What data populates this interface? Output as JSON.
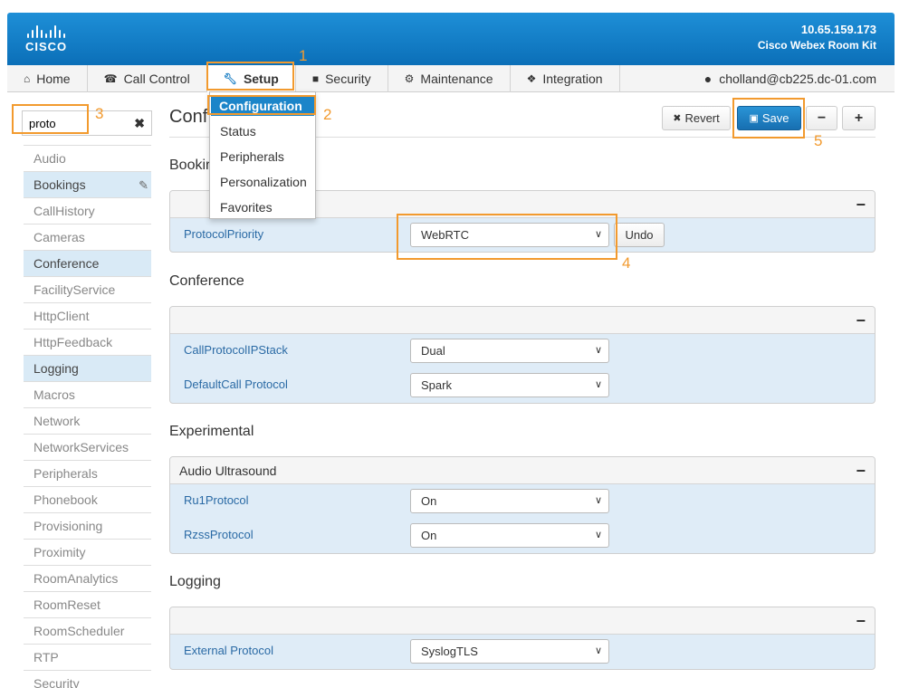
{
  "header": {
    "brand": "CISCO",
    "ip": "10.65.159.173",
    "device": "Cisco Webex Room Kit"
  },
  "nav": {
    "items": [
      {
        "label": "Home",
        "icon": "home-icon"
      },
      {
        "label": "Call Control",
        "icon": "phone-icon"
      },
      {
        "label": "Setup",
        "icon": "wrench-icon"
      },
      {
        "label": "Security",
        "icon": "lock-icon"
      },
      {
        "label": "Maintenance",
        "icon": "gear-icon"
      },
      {
        "label": "Integration",
        "icon": "puzzle-icon"
      }
    ],
    "user": "cholland@cb225.dc-01.com"
  },
  "setup_menu": {
    "items": [
      "Configuration",
      "Status",
      "Peripherals",
      "Personalization",
      "Favorites"
    ]
  },
  "search": {
    "value": "proto"
  },
  "sidebar": {
    "items": [
      {
        "label": "Audio"
      },
      {
        "label": "Bookings"
      },
      {
        "label": "CallHistory"
      },
      {
        "label": "Cameras"
      },
      {
        "label": "Conference"
      },
      {
        "label": "FacilityService"
      },
      {
        "label": "HttpClient"
      },
      {
        "label": "HttpFeedback"
      },
      {
        "label": "Logging"
      },
      {
        "label": "Macros"
      },
      {
        "label": "Network"
      },
      {
        "label": "NetworkServices"
      },
      {
        "label": "Peripherals"
      },
      {
        "label": "Phonebook"
      },
      {
        "label": "Provisioning"
      },
      {
        "label": "Proximity"
      },
      {
        "label": "RoomAnalytics"
      },
      {
        "label": "RoomReset"
      },
      {
        "label": "RoomScheduler"
      },
      {
        "label": "RTP"
      },
      {
        "label": "Security"
      }
    ]
  },
  "main": {
    "title": "Conf",
    "revert_label": "Revert",
    "save_label": "Save",
    "minus_label": "−",
    "plus_label": "+",
    "undo_label": "Undo",
    "sections": [
      {
        "title": "Bookir",
        "panel_title": "",
        "rows": [
          {
            "label": "ProtocolPriority",
            "value": "WebRTC"
          }
        ]
      },
      {
        "title": "Conference",
        "panel_title": "",
        "rows": [
          {
            "label": "CallProtocolIPStack",
            "value": "Dual"
          },
          {
            "label": "DefaultCall Protocol",
            "value": "Spark"
          }
        ]
      },
      {
        "title": "Experimental",
        "panel_title": "Audio Ultrasound",
        "rows": [
          {
            "label": "Ru1Protocol",
            "value": "On"
          },
          {
            "label": "RzssProtocol",
            "value": "On"
          }
        ]
      },
      {
        "title": "Logging",
        "panel_title": "",
        "rows": [
          {
            "label": "External Protocol",
            "value": "SyslogTLS"
          }
        ]
      }
    ]
  },
  "callouts": [
    "1",
    "2",
    "3",
    "4",
    "5"
  ],
  "colors": {
    "header_blue": "#0b6fb8",
    "accent_orange": "#f29a2e",
    "row_blue": "#dfecf7",
    "save_blue": "#1b7fc4"
  }
}
